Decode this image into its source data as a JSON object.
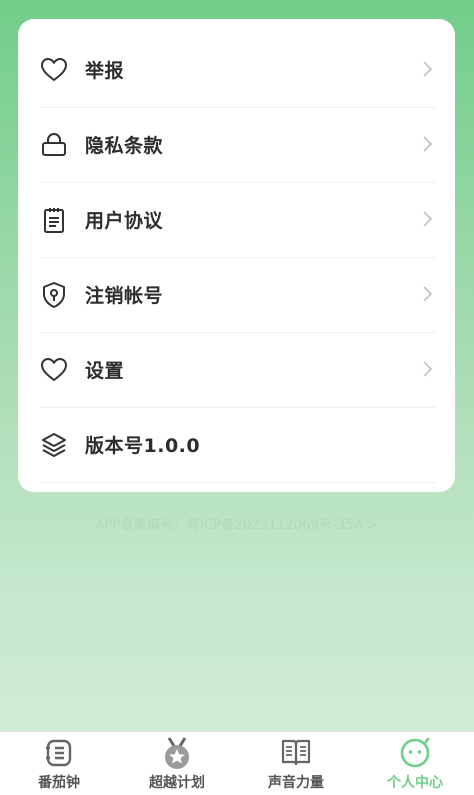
{
  "menu": {
    "items": [
      {
        "label": "举报",
        "icon": "heart-icon",
        "has_arrow": true
      },
      {
        "label": "隐私条款",
        "icon": "lock-icon",
        "has_arrow": true
      },
      {
        "label": "用户协议",
        "icon": "clipboard-icon",
        "has_arrow": true
      },
      {
        "label": "注销帐号",
        "icon": "shield-icon",
        "has_arrow": true
      },
      {
        "label": "设置",
        "icon": "heart-icon",
        "has_arrow": true
      },
      {
        "label": "版本号1.0.0",
        "icon": "layers-icon",
        "has_arrow": false
      }
    ]
  },
  "footer": {
    "icp": "APP备案编号：粤ICP备2023112069号-35A >"
  },
  "tabbar": {
    "tabs": [
      {
        "label": "番茄钟",
        "icon": "timer-icon",
        "active": false
      },
      {
        "label": "超越计划",
        "icon": "medal-icon",
        "active": false
      },
      {
        "label": "声音力量",
        "icon": "book-icon",
        "active": false
      },
      {
        "label": "个人中心",
        "icon": "smile-face-icon",
        "active": true
      }
    ],
    "active_color": "#6fcf86",
    "inactive_color": "#555555"
  },
  "colors": {
    "background_top": "#72cd8a",
    "background_bottom": "#d4eed8",
    "card": "#ffffff"
  }
}
